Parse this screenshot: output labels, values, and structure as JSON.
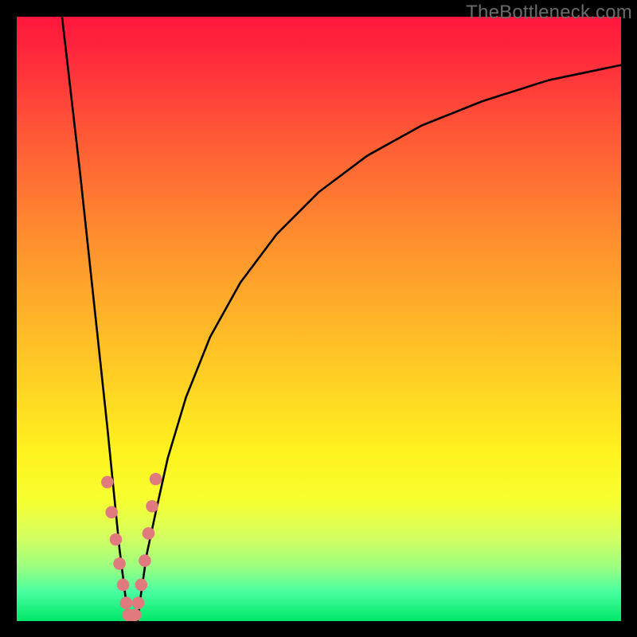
{
  "watermark": "TheBottleneck.com",
  "chart_data": {
    "type": "line",
    "title": "",
    "xlabel": "",
    "ylabel": "",
    "xlim": [
      0,
      100
    ],
    "ylim": [
      0,
      100
    ],
    "series": [
      {
        "name": "left-branch",
        "x": [
          7.5,
          9,
          10.5,
          12,
          13.5,
          15,
          16,
          17,
          18,
          18.5
        ],
        "y": [
          100,
          87,
          74,
          60,
          46,
          32,
          22,
          12,
          4,
          0
        ]
      },
      {
        "name": "right-branch",
        "x": [
          20,
          20.5,
          21.5,
          23,
          25,
          28,
          32,
          37,
          43,
          50,
          58,
          67,
          77,
          88,
          100
        ],
        "y": [
          0,
          4,
          11,
          18,
          27,
          37,
          47,
          56,
          64,
          71,
          77,
          82,
          86,
          89.5,
          92
        ]
      }
    ],
    "markers": {
      "name": "data-dots",
      "color": "#e07a7f",
      "points_xy": [
        [
          15.0,
          23
        ],
        [
          15.7,
          18
        ],
        [
          16.4,
          13.5
        ],
        [
          17.0,
          9.5
        ],
        [
          17.6,
          6
        ],
        [
          18.1,
          3
        ],
        [
          18.5,
          1
        ],
        [
          19.0,
          0.5
        ],
        [
          19.6,
          1
        ],
        [
          20.1,
          3
        ],
        [
          20.6,
          6
        ],
        [
          21.2,
          10
        ],
        [
          21.8,
          14.5
        ],
        [
          22.4,
          19
        ],
        [
          23.0,
          23.5
        ]
      ]
    }
  }
}
